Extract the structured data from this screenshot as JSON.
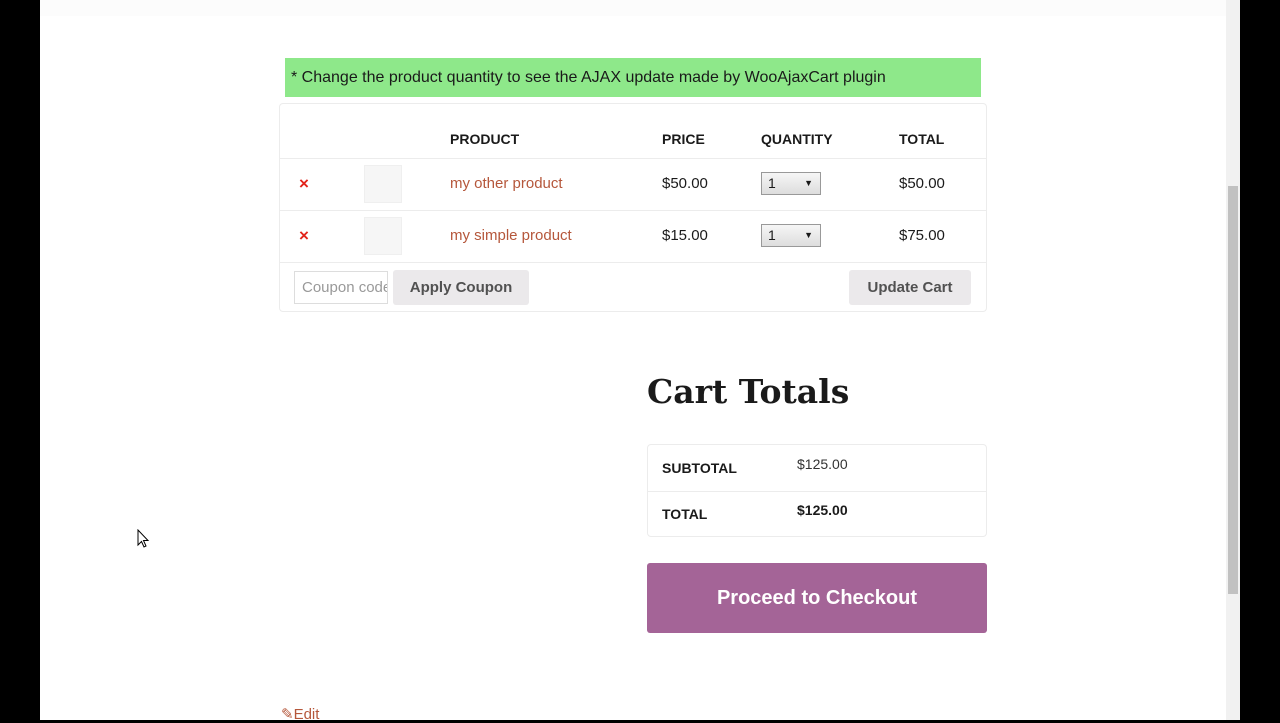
{
  "notice": "* Change the product quantity to see the AJAX update made by WooAjaxCart plugin",
  "cart": {
    "headers": {
      "product": "PRODUCT",
      "price": "PRICE",
      "quantity": "QUANTITY",
      "total": "TOTAL"
    },
    "rows": [
      {
        "name": "my other product",
        "price": "$50.00",
        "quantity": "1",
        "total": "$50.00"
      },
      {
        "name": "my simple product",
        "price": "$15.00",
        "quantity": "1",
        "total": "$75.00"
      }
    ],
    "remove_symbol": "×",
    "coupon_placeholder": "Coupon code",
    "apply_coupon": "Apply Coupon",
    "update_cart": "Update Cart"
  },
  "totals": {
    "title": "Cart Totals",
    "subtotal_label": "SUBTOTAL",
    "subtotal_value": "$125.00",
    "total_label": "TOTAL",
    "total_value": "$125.00",
    "checkout": "Proceed to Checkout"
  },
  "edit_link": "Edit",
  "colors": {
    "notice": "#8ee88a",
    "link": "#b5573b",
    "checkout": "#a46497",
    "remove": "#e2231a"
  }
}
